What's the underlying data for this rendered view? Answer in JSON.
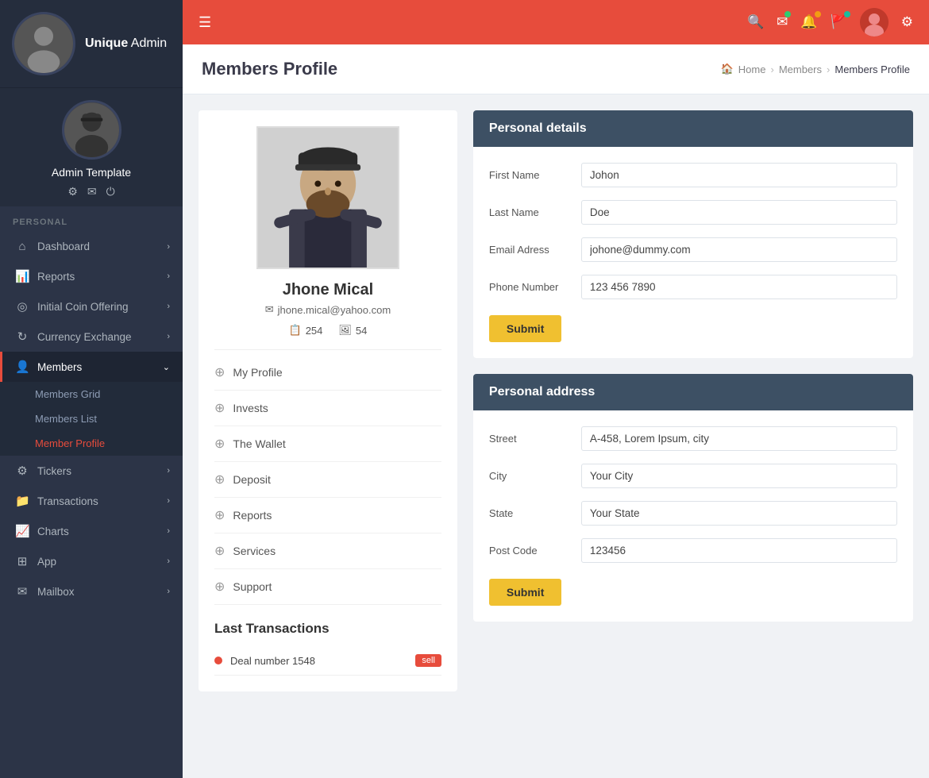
{
  "brand": {
    "name_bold": "Unique",
    "name_light": " Admin"
  },
  "sidebar_user": {
    "username": "Admin Template"
  },
  "nav": {
    "personal_label": "PERSONAL",
    "items": [
      {
        "id": "dashboard",
        "label": "Dashboard",
        "icon": "⌂",
        "has_arrow": true,
        "active": false
      },
      {
        "id": "reports",
        "label": "Reports",
        "icon": "📊",
        "has_arrow": true,
        "active": false
      },
      {
        "id": "ico",
        "label": "Initial Coin Offering",
        "icon": "◎",
        "has_arrow": true,
        "active": false
      },
      {
        "id": "currency",
        "label": "Currency Exchange",
        "icon": "↻",
        "has_arrow": true,
        "active": false
      },
      {
        "id": "members",
        "label": "Members",
        "icon": "👤",
        "has_arrow": true,
        "active": true
      },
      {
        "id": "tickers",
        "label": "Tickers",
        "icon": "⚙",
        "has_arrow": true,
        "active": false
      },
      {
        "id": "transactions",
        "label": "Transactions",
        "icon": "📁",
        "has_arrow": true,
        "active": false
      },
      {
        "id": "charts",
        "label": "Charts",
        "icon": "📈",
        "has_arrow": true,
        "active": false
      },
      {
        "id": "app",
        "label": "App",
        "icon": "⊞",
        "has_arrow": true,
        "active": false
      },
      {
        "id": "mailbox",
        "label": "Mailbox",
        "icon": "✉",
        "has_arrow": true,
        "active": false
      }
    ],
    "members_sub": [
      {
        "id": "members-grid",
        "label": "Members Grid",
        "active": false
      },
      {
        "id": "members-list",
        "label": "Members List",
        "active": false
      },
      {
        "id": "member-profile",
        "label": "Member Profile",
        "active": true
      }
    ]
  },
  "topbar": {
    "menu_icon": "☰"
  },
  "page": {
    "title": "Members Profile",
    "breadcrumb": {
      "home": "Home",
      "parent": "Members",
      "current": "Members Profile"
    }
  },
  "profile": {
    "name": "Jhone Mical",
    "email": "jhone.mical@yahoo.com",
    "posts_label": "254",
    "photos_label": "54",
    "menu_items": [
      {
        "id": "my-profile",
        "label": "My Profile"
      },
      {
        "id": "invests",
        "label": "Invests"
      },
      {
        "id": "the-wallet",
        "label": "The Wallet"
      },
      {
        "id": "deposit",
        "label": "Deposit"
      },
      {
        "id": "reports",
        "label": "Reports"
      },
      {
        "id": "services",
        "label": "Services"
      },
      {
        "id": "support",
        "label": "Support"
      }
    ]
  },
  "last_transactions": {
    "title": "Last Transactions",
    "items": [
      {
        "id": "tx1",
        "label": "Deal number 1548",
        "badge": "sell",
        "dot_color": "red"
      }
    ]
  },
  "personal_details": {
    "header": "Personal details",
    "fields": [
      {
        "id": "first-name",
        "label": "First Name",
        "value": "Johon",
        "type": "text"
      },
      {
        "id": "last-name",
        "label": "Last Name",
        "value": "Doe",
        "type": "text"
      },
      {
        "id": "email",
        "label": "Email Adress",
        "value": "johone@dummy.com",
        "type": "text"
      },
      {
        "id": "phone",
        "label": "Phone Number",
        "value": "123 456 7890",
        "type": "text"
      }
    ],
    "submit_label": "Submit"
  },
  "personal_address": {
    "header": "Personal address",
    "fields": [
      {
        "id": "street",
        "label": "Street",
        "value": "A-458, Lorem Ipsum, city",
        "type": "text"
      },
      {
        "id": "city",
        "label": "City",
        "value": "Your City",
        "type": "text"
      },
      {
        "id": "state",
        "label": "State",
        "value": "Your State",
        "type": "text"
      },
      {
        "id": "postcode",
        "label": "Post Code",
        "value": "123456",
        "type": "number"
      }
    ],
    "submit_label": "Submit"
  }
}
